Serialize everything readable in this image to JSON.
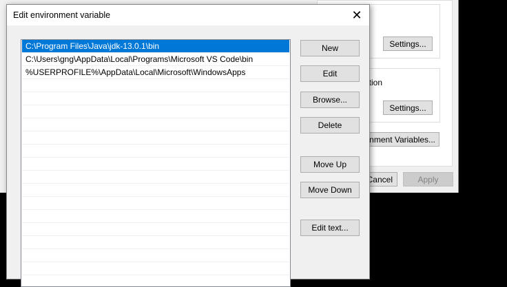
{
  "background_window": {
    "settings1": "Settings...",
    "partial_label": "tion",
    "settings2": "Settings...",
    "env_vars": "Environment Variables...",
    "cancel": "Cancel",
    "apply": "Apply"
  },
  "dialog": {
    "title": "Edit environment variable",
    "entries": [
      "C:\\Program Files\\Java\\jdk-13.0.1\\bin",
      "C:\\Users\\gng\\AppData\\Local\\Programs\\Microsoft VS Code\\bin",
      "%USERPROFILE%\\AppData\\Local\\Microsoft\\WindowsApps"
    ],
    "buttons": {
      "new": "New",
      "edit": "Edit",
      "browse": "Browse...",
      "delete": "Delete",
      "move_up": "Move Up",
      "move_down": "Move Down",
      "edit_text": "Edit text..."
    }
  }
}
